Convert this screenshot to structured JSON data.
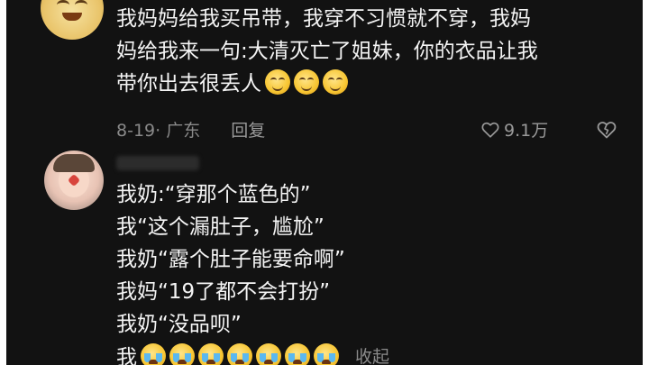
{
  "comment1": {
    "line1": "我妈妈给我买吊带，我穿不习惯就不穿，我妈",
    "line2": "妈给我来一句:大清灭亡了姐妹，你的衣品让我",
    "line3": "带你出去很丢人",
    "emoji_trail": "smile-emoji x3",
    "date": "8-19",
    "location": "· 广东",
    "reply_label": "回复",
    "likes": "9.1万"
  },
  "comment2": {
    "lines": [
      "我奶:“穿那个蓝色的”",
      "我“这个漏肚子，尴尬”",
      "我奶“露个肚子能要命啊”",
      "我妈“19了都不会打扮”",
      "我奶“没品呗”",
      "我"
    ],
    "emoji_trail": "crying-emoji x7",
    "collapse_label": "收起"
  },
  "colors": {
    "background": "#121212",
    "text": "#f4f4f4",
    "meta": "#8a8a8a"
  }
}
